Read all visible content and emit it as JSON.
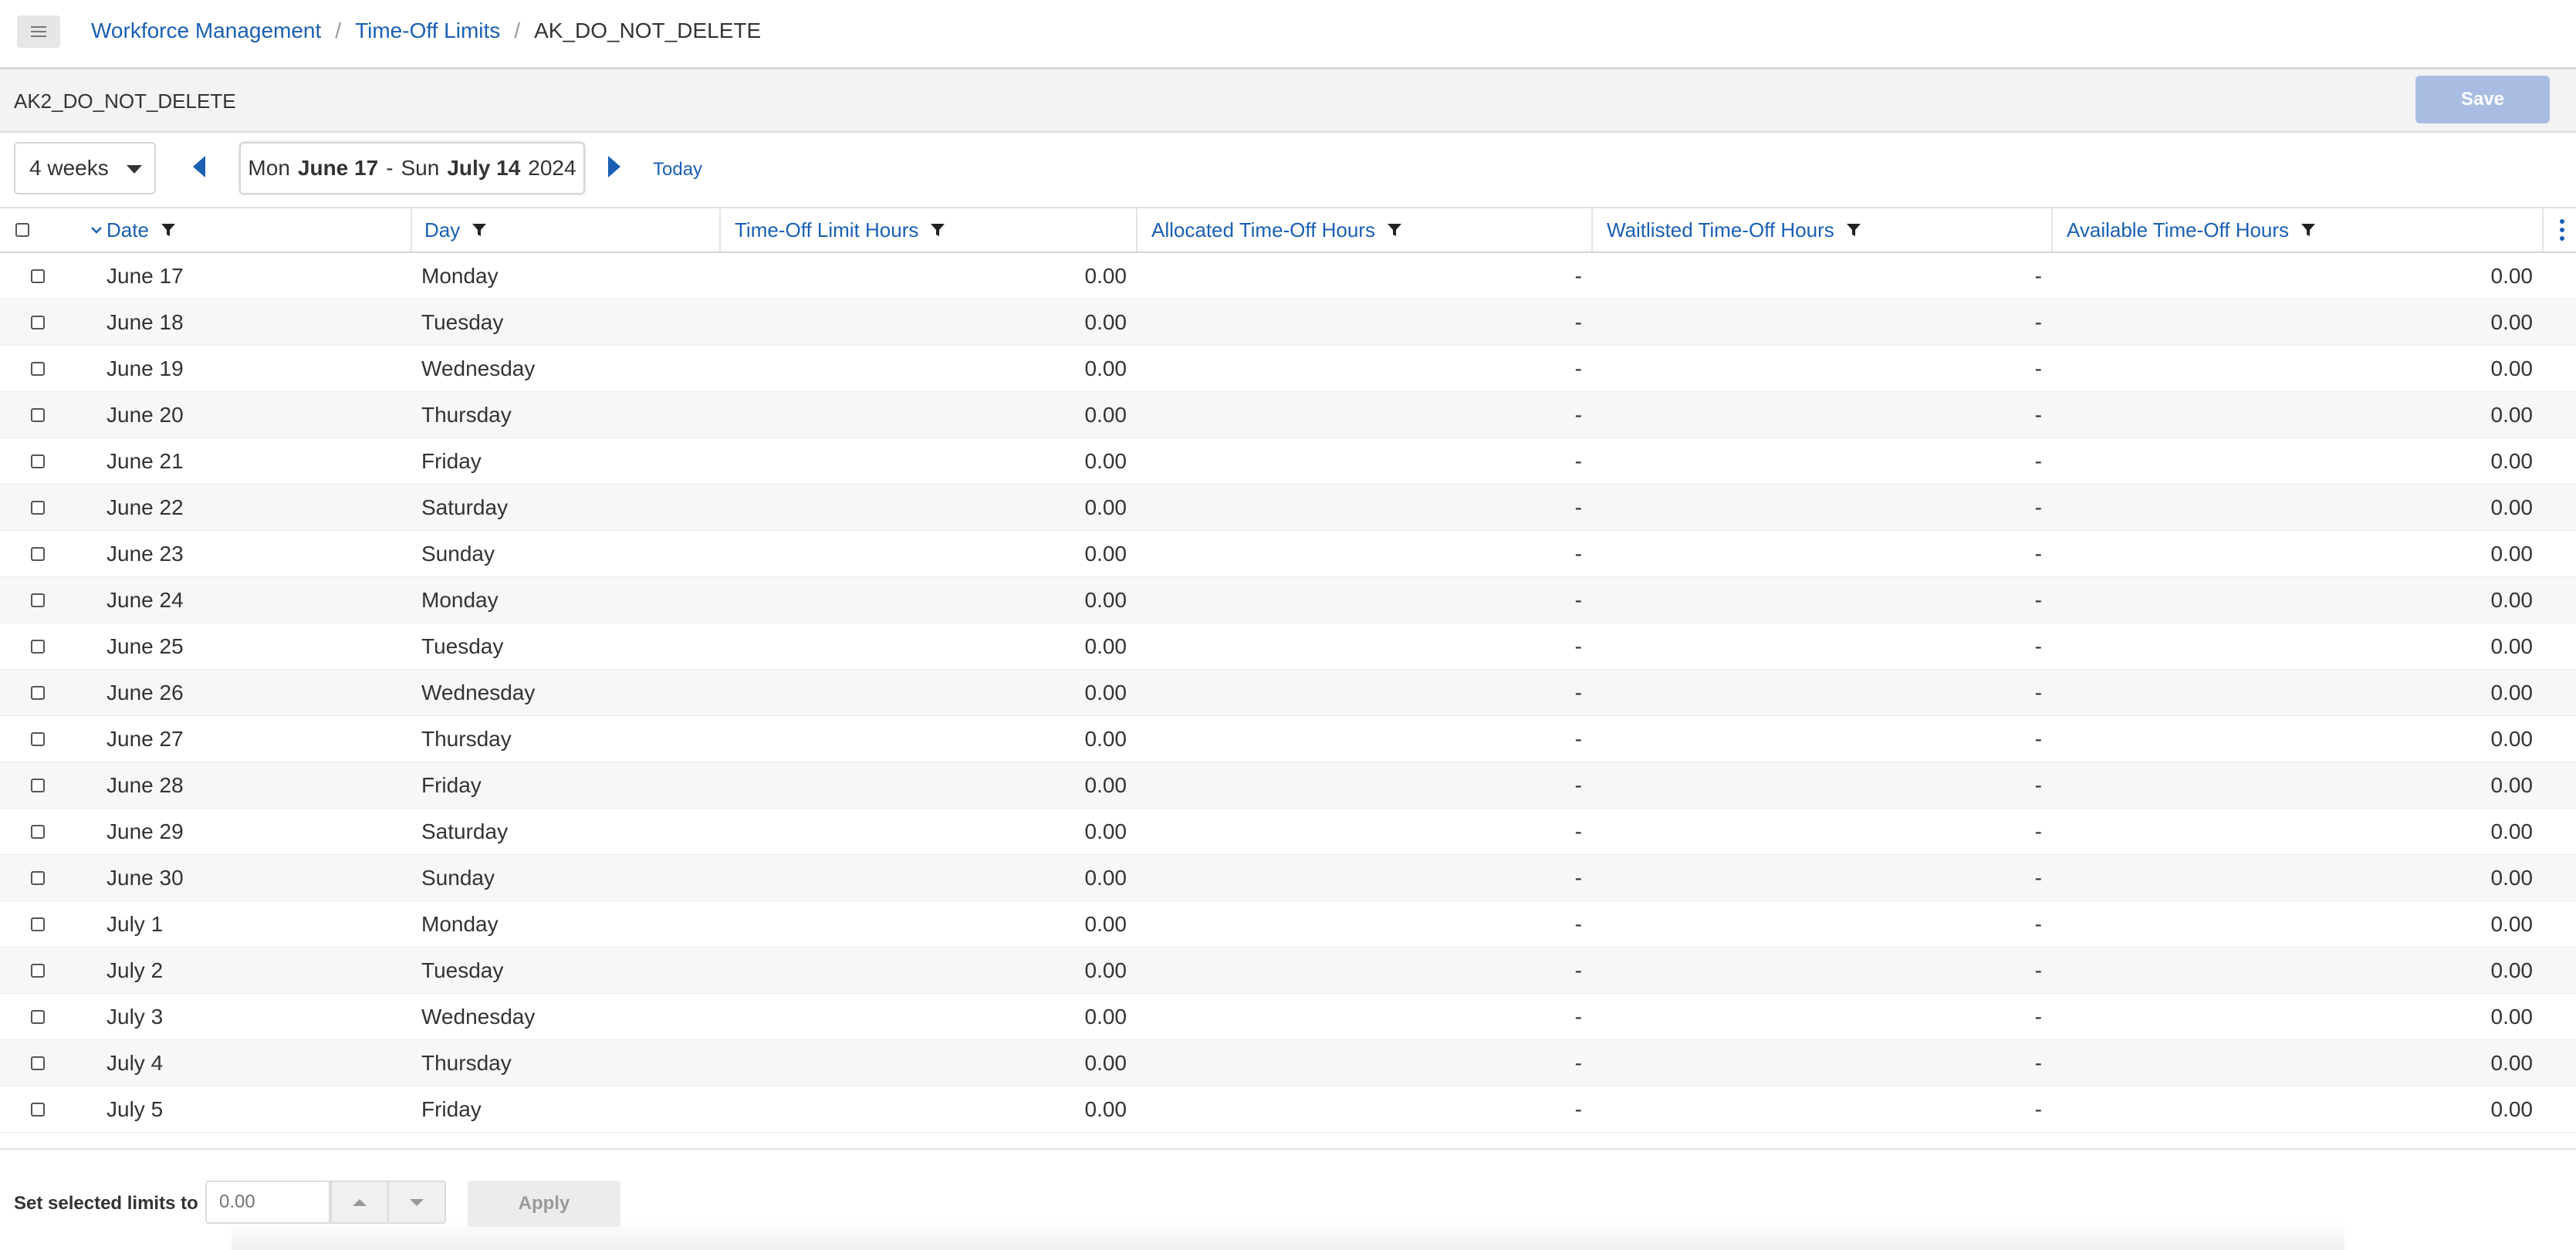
{
  "header": {
    "breadcrumb": {
      "item1": "Workforce Management",
      "item2": "Time-Off Limits",
      "current": "AK_DO_NOT_DELETE",
      "separator": "/"
    }
  },
  "titlebar": {
    "title": "AK2_DO_NOT_DELETE",
    "save_label": "Save"
  },
  "controls": {
    "period_select": "4 weeks",
    "range": {
      "start_day": "Mon",
      "start_date": "June 17",
      "dash": "-",
      "end_day": "Sun",
      "end_date": "July 14",
      "year": "2024"
    },
    "today_label": "Today"
  },
  "table": {
    "columns": {
      "date": "Date",
      "day": "Day",
      "limit": "Time-Off Limit Hours",
      "allocated": "Allocated Time-Off Hours",
      "waitlisted": "Waitlisted Time-Off Hours",
      "available": "Available Time-Off Hours"
    },
    "rows": [
      {
        "date": "June 17",
        "day": "Monday",
        "limit": "0.00",
        "allocated": "-",
        "waitlisted": "-",
        "available": "0.00"
      },
      {
        "date": "June 18",
        "day": "Tuesday",
        "limit": "0.00",
        "allocated": "-",
        "waitlisted": "-",
        "available": "0.00"
      },
      {
        "date": "June 19",
        "day": "Wednesday",
        "limit": "0.00",
        "allocated": "-",
        "waitlisted": "-",
        "available": "0.00"
      },
      {
        "date": "June 20",
        "day": "Thursday",
        "limit": "0.00",
        "allocated": "-",
        "waitlisted": "-",
        "available": "0.00"
      },
      {
        "date": "June 21",
        "day": "Friday",
        "limit": "0.00",
        "allocated": "-",
        "waitlisted": "-",
        "available": "0.00"
      },
      {
        "date": "June 22",
        "day": "Saturday",
        "limit": "0.00",
        "allocated": "-",
        "waitlisted": "-",
        "available": "0.00"
      },
      {
        "date": "June 23",
        "day": "Sunday",
        "limit": "0.00",
        "allocated": "-",
        "waitlisted": "-",
        "available": "0.00"
      },
      {
        "date": "June 24",
        "day": "Monday",
        "limit": "0.00",
        "allocated": "-",
        "waitlisted": "-",
        "available": "0.00"
      },
      {
        "date": "June 25",
        "day": "Tuesday",
        "limit": "0.00",
        "allocated": "-",
        "waitlisted": "-",
        "available": "0.00"
      },
      {
        "date": "June 26",
        "day": "Wednesday",
        "limit": "0.00",
        "allocated": "-",
        "waitlisted": "-",
        "available": "0.00"
      },
      {
        "date": "June 27",
        "day": "Thursday",
        "limit": "0.00",
        "allocated": "-",
        "waitlisted": "-",
        "available": "0.00"
      },
      {
        "date": "June 28",
        "day": "Friday",
        "limit": "0.00",
        "allocated": "-",
        "waitlisted": "-",
        "available": "0.00"
      },
      {
        "date": "June 29",
        "day": "Saturday",
        "limit": "0.00",
        "allocated": "-",
        "waitlisted": "-",
        "available": "0.00"
      },
      {
        "date": "June 30",
        "day": "Sunday",
        "limit": "0.00",
        "allocated": "-",
        "waitlisted": "-",
        "available": "0.00"
      },
      {
        "date": "July 1",
        "day": "Monday",
        "limit": "0.00",
        "allocated": "-",
        "waitlisted": "-",
        "available": "0.00"
      },
      {
        "date": "July 2",
        "day": "Tuesday",
        "limit": "0.00",
        "allocated": "-",
        "waitlisted": "-",
        "available": "0.00"
      },
      {
        "date": "July 3",
        "day": "Wednesday",
        "limit": "0.00",
        "allocated": "-",
        "waitlisted": "-",
        "available": "0.00"
      },
      {
        "date": "July 4",
        "day": "Thursday",
        "limit": "0.00",
        "allocated": "-",
        "waitlisted": "-",
        "available": "0.00"
      },
      {
        "date": "July 5",
        "day": "Friday",
        "limit": "0.00",
        "allocated": "-",
        "waitlisted": "-",
        "available": "0.00"
      }
    ]
  },
  "footer": {
    "set_label": "Set selected limits to",
    "input_placeholder": "0.00",
    "apply_label": "Apply"
  },
  "colors": {
    "link": "#1a5fb4",
    "save_disabled": "#a9bde2",
    "row_alt": "#f7f7f7"
  },
  "icons": {
    "menu": "hamburger-icon",
    "filter": "filter-funnel-icon",
    "sort": "sort-chevron-down-icon",
    "more": "kebab-vertical-icon"
  }
}
